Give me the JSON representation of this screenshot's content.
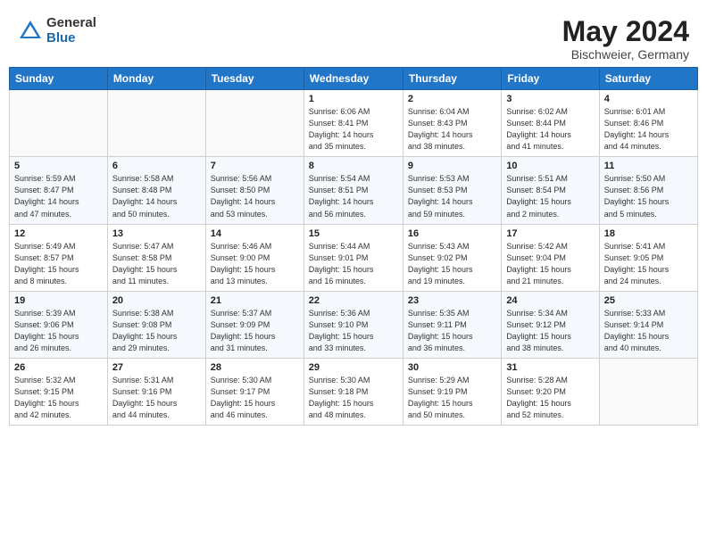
{
  "header": {
    "logo_general": "General",
    "logo_blue": "Blue",
    "month_year": "May 2024",
    "location": "Bischweier, Germany"
  },
  "weekdays": [
    "Sunday",
    "Monday",
    "Tuesday",
    "Wednesday",
    "Thursday",
    "Friday",
    "Saturday"
  ],
  "weeks": [
    [
      {
        "num": "",
        "info": ""
      },
      {
        "num": "",
        "info": ""
      },
      {
        "num": "",
        "info": ""
      },
      {
        "num": "1",
        "info": "Sunrise: 6:06 AM\nSunset: 8:41 PM\nDaylight: 14 hours\nand 35 minutes."
      },
      {
        "num": "2",
        "info": "Sunrise: 6:04 AM\nSunset: 8:43 PM\nDaylight: 14 hours\nand 38 minutes."
      },
      {
        "num": "3",
        "info": "Sunrise: 6:02 AM\nSunset: 8:44 PM\nDaylight: 14 hours\nand 41 minutes."
      },
      {
        "num": "4",
        "info": "Sunrise: 6:01 AM\nSunset: 8:46 PM\nDaylight: 14 hours\nand 44 minutes."
      }
    ],
    [
      {
        "num": "5",
        "info": "Sunrise: 5:59 AM\nSunset: 8:47 PM\nDaylight: 14 hours\nand 47 minutes."
      },
      {
        "num": "6",
        "info": "Sunrise: 5:58 AM\nSunset: 8:48 PM\nDaylight: 14 hours\nand 50 minutes."
      },
      {
        "num": "7",
        "info": "Sunrise: 5:56 AM\nSunset: 8:50 PM\nDaylight: 14 hours\nand 53 minutes."
      },
      {
        "num": "8",
        "info": "Sunrise: 5:54 AM\nSunset: 8:51 PM\nDaylight: 14 hours\nand 56 minutes."
      },
      {
        "num": "9",
        "info": "Sunrise: 5:53 AM\nSunset: 8:53 PM\nDaylight: 14 hours\nand 59 minutes."
      },
      {
        "num": "10",
        "info": "Sunrise: 5:51 AM\nSunset: 8:54 PM\nDaylight: 15 hours\nand 2 minutes."
      },
      {
        "num": "11",
        "info": "Sunrise: 5:50 AM\nSunset: 8:56 PM\nDaylight: 15 hours\nand 5 minutes."
      }
    ],
    [
      {
        "num": "12",
        "info": "Sunrise: 5:49 AM\nSunset: 8:57 PM\nDaylight: 15 hours\nand 8 minutes."
      },
      {
        "num": "13",
        "info": "Sunrise: 5:47 AM\nSunset: 8:58 PM\nDaylight: 15 hours\nand 11 minutes."
      },
      {
        "num": "14",
        "info": "Sunrise: 5:46 AM\nSunset: 9:00 PM\nDaylight: 15 hours\nand 13 minutes."
      },
      {
        "num": "15",
        "info": "Sunrise: 5:44 AM\nSunset: 9:01 PM\nDaylight: 15 hours\nand 16 minutes."
      },
      {
        "num": "16",
        "info": "Sunrise: 5:43 AM\nSunset: 9:02 PM\nDaylight: 15 hours\nand 19 minutes."
      },
      {
        "num": "17",
        "info": "Sunrise: 5:42 AM\nSunset: 9:04 PM\nDaylight: 15 hours\nand 21 minutes."
      },
      {
        "num": "18",
        "info": "Sunrise: 5:41 AM\nSunset: 9:05 PM\nDaylight: 15 hours\nand 24 minutes."
      }
    ],
    [
      {
        "num": "19",
        "info": "Sunrise: 5:39 AM\nSunset: 9:06 PM\nDaylight: 15 hours\nand 26 minutes."
      },
      {
        "num": "20",
        "info": "Sunrise: 5:38 AM\nSunset: 9:08 PM\nDaylight: 15 hours\nand 29 minutes."
      },
      {
        "num": "21",
        "info": "Sunrise: 5:37 AM\nSunset: 9:09 PM\nDaylight: 15 hours\nand 31 minutes."
      },
      {
        "num": "22",
        "info": "Sunrise: 5:36 AM\nSunset: 9:10 PM\nDaylight: 15 hours\nand 33 minutes."
      },
      {
        "num": "23",
        "info": "Sunrise: 5:35 AM\nSunset: 9:11 PM\nDaylight: 15 hours\nand 36 minutes."
      },
      {
        "num": "24",
        "info": "Sunrise: 5:34 AM\nSunset: 9:12 PM\nDaylight: 15 hours\nand 38 minutes."
      },
      {
        "num": "25",
        "info": "Sunrise: 5:33 AM\nSunset: 9:14 PM\nDaylight: 15 hours\nand 40 minutes."
      }
    ],
    [
      {
        "num": "26",
        "info": "Sunrise: 5:32 AM\nSunset: 9:15 PM\nDaylight: 15 hours\nand 42 minutes."
      },
      {
        "num": "27",
        "info": "Sunrise: 5:31 AM\nSunset: 9:16 PM\nDaylight: 15 hours\nand 44 minutes."
      },
      {
        "num": "28",
        "info": "Sunrise: 5:30 AM\nSunset: 9:17 PM\nDaylight: 15 hours\nand 46 minutes."
      },
      {
        "num": "29",
        "info": "Sunrise: 5:30 AM\nSunset: 9:18 PM\nDaylight: 15 hours\nand 48 minutes."
      },
      {
        "num": "30",
        "info": "Sunrise: 5:29 AM\nSunset: 9:19 PM\nDaylight: 15 hours\nand 50 minutes."
      },
      {
        "num": "31",
        "info": "Sunrise: 5:28 AM\nSunset: 9:20 PM\nDaylight: 15 hours\nand 52 minutes."
      },
      {
        "num": "",
        "info": ""
      }
    ]
  ]
}
